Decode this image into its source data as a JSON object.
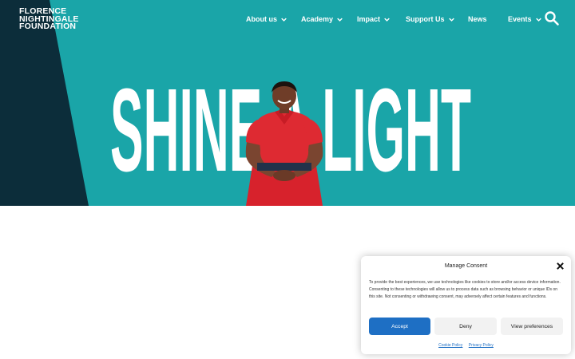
{
  "logo": {
    "line1": "FLORENCE",
    "line2": "NIGHTINGALE",
    "line3": "FOUNDATION"
  },
  "nav": {
    "items": [
      {
        "label": "About us",
        "has_dropdown": true
      },
      {
        "label": "Academy",
        "has_dropdown": true
      },
      {
        "label": "Impact",
        "has_dropdown": true
      },
      {
        "label": "Support Us",
        "has_dropdown": true
      },
      {
        "label": "News",
        "has_dropdown": false
      },
      {
        "label": "Events",
        "has_dropdown": true
      }
    ],
    "search_icon": "search-icon"
  },
  "hero": {
    "headline": "SHINE A LIGHT",
    "colors": {
      "background": "#1aa5a8",
      "dark": "#0c2d3a",
      "text": "#ffffff"
    }
  },
  "consent": {
    "title": "Manage Consent",
    "body": "To provide the best experiences, we use technologies like cookies to store and/or access device information. Consenting to these technologies will allow us to process data such as browsing behavior or unique IDs on this site. Not consenting or withdrawing consent, may adversely affect certain features and functions.",
    "accept": "Accept",
    "deny": "Deny",
    "preferences": "View preferences",
    "cookie_policy": "Cookie Policy",
    "privacy_policy": "Privacy Policy",
    "accent": "#1e6fc4"
  }
}
